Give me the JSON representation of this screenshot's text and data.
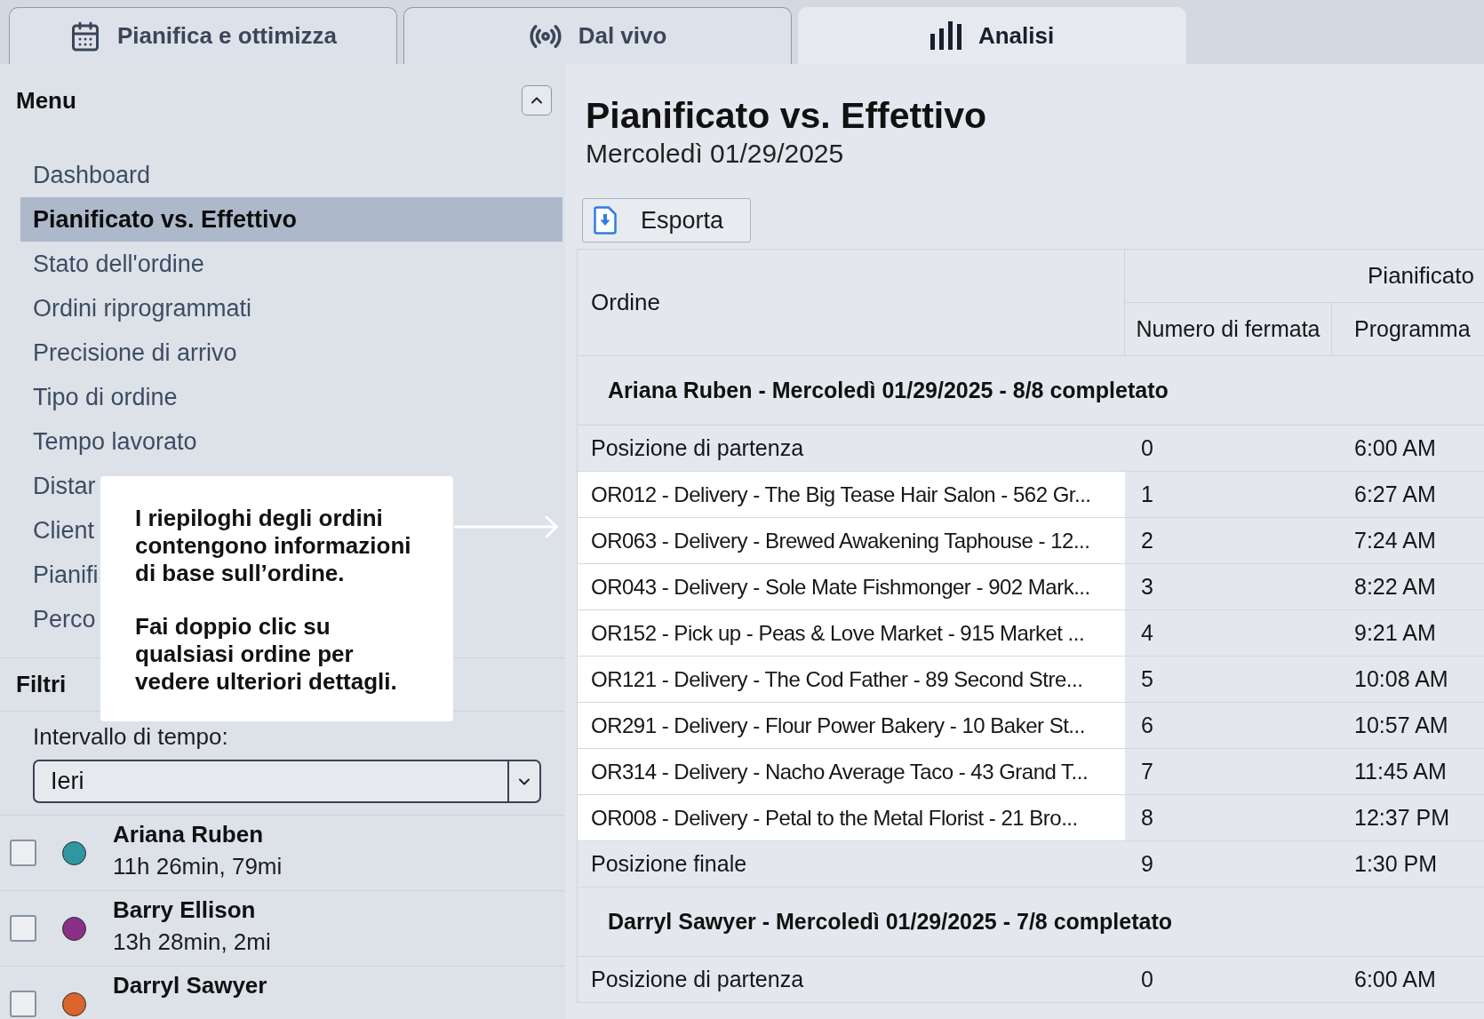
{
  "tabs": [
    {
      "label": "Pianifica e ottimizza",
      "selected": false
    },
    {
      "label": "Dal vivo",
      "selected": false
    },
    {
      "label": "Analisi",
      "selected": true
    }
  ],
  "sidebar": {
    "menu": {
      "title": "Menu",
      "expanded": true,
      "items": [
        {
          "label": "Dashboard",
          "selected": false
        },
        {
          "label": "Pianificato vs. Effettivo",
          "selected": true
        },
        {
          "label": "Stato dell'ordine",
          "selected": false
        },
        {
          "label": "Ordini riprogrammati",
          "selected": false
        },
        {
          "label": "Precisione di arrivo",
          "selected": false
        },
        {
          "label": "Tipo di ordine",
          "selected": false
        },
        {
          "label": "Tempo lavorato",
          "selected": false
        },
        {
          "label": "Distar",
          "selected": false
        },
        {
          "label": "Client",
          "selected": false
        },
        {
          "label": "Pianifi",
          "selected": false
        },
        {
          "label": "Perco",
          "selected": false
        }
      ]
    },
    "filters": {
      "title": "Filtri",
      "time_range": {
        "label": "Intervallo di tempo:",
        "value": "Ieri"
      },
      "drivers": [
        {
          "name": "Ariana Ruben",
          "summary": "11h 26min, 79mi",
          "checked": false,
          "color": "#2f97a0"
        },
        {
          "name": "Barry Ellison",
          "summary": "13h 28min, 2mi",
          "checked": false,
          "color": "#8a2f86"
        },
        {
          "name": "Darryl Sawyer",
          "checked": false,
          "color": "#d9652a"
        }
      ]
    }
  },
  "callout": {
    "paragraphs": [
      "I riepiloghi degli ordini contengono informazioni di base sull’ordine.",
      "Fai doppio clic su qualsiasi ordine per vedere ulteriori dettagli."
    ]
  },
  "report": {
    "title": "Pianificato vs. Effettivo",
    "subtitle": "Mercoledì 01/29/2025",
    "export_button": "Esporta",
    "table": {
      "columns": {
        "order": "Ordine",
        "group": "Pianificato",
        "stop_number": "Numero di fermata",
        "schedule": "Programma"
      },
      "groups": [
        {
          "title": "Ariana Ruben - Mercoledì 01/29/2025 - 8/8 completato",
          "rows": [
            {
              "kind": "location",
              "order": "Posizione di partenza",
              "stop": "0",
              "time": "6:00 AM"
            },
            {
              "kind": "order",
              "order": "OR012 - Delivery - The Big Tease Hair Salon - 562 Gr...",
              "stop": "1",
              "time": "6:27 AM"
            },
            {
              "kind": "order",
              "order": "OR063 - Delivery - Brewed Awakening Taphouse - 12...",
              "stop": "2",
              "time": "7:24 AM"
            },
            {
              "kind": "order",
              "order": "OR043 - Delivery - Sole Mate Fishmonger - 902 Mark...",
              "stop": "3",
              "time": "8:22 AM"
            },
            {
              "kind": "order",
              "order": "OR152 - Pick up - Peas & Love Market - 915 Market ...",
              "stop": "4",
              "time": "9:21 AM"
            },
            {
              "kind": "order",
              "order": "OR121 - Delivery - The Cod Father - 89 Second Stre...",
              "stop": "5",
              "time": "10:08 AM"
            },
            {
              "kind": "order",
              "order": "OR291 - Delivery - Flour Power Bakery - 10 Baker St...",
              "stop": "6",
              "time": "10:57 AM"
            },
            {
              "kind": "order",
              "order": "OR314 - Delivery - Nacho Average Taco - 43 Grand T...",
              "stop": "7",
              "time": "11:45 AM"
            },
            {
              "kind": "order",
              "order": "OR008 - Delivery - Petal to the Metal Florist - 21 Bro...",
              "stop": "8",
              "time": "12:37 PM"
            },
            {
              "kind": "location",
              "order": "Posizione finale",
              "stop": "9",
              "time": "1:30 PM"
            }
          ]
        },
        {
          "title": "Darryl Sawyer - Mercoledì 01/29/2025 - 7/8 completato",
          "rows": [
            {
              "kind": "location",
              "order": "Posizione di partenza",
              "stop": "0",
              "time": "6:00 AM"
            }
          ]
        }
      ]
    }
  }
}
